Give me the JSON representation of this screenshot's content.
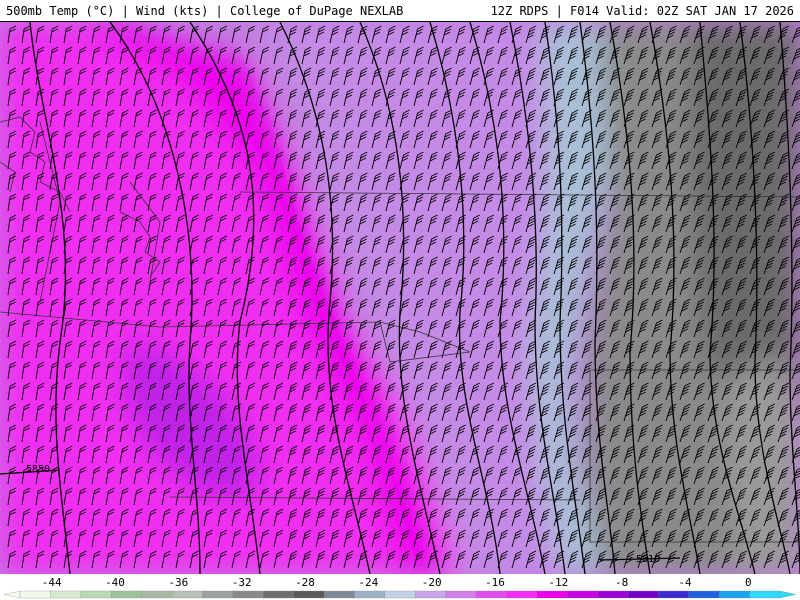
{
  "header": {
    "left": "500mb Temp (°C) | Wind (kts) | College of DuPage NEXLAB",
    "right": "12Z RDPS | F014 Valid: 02Z SAT JAN 17 2026"
  },
  "contour_labels": [
    "5850",
    "5610"
  ],
  "colorbar": {
    "ticks": [
      "-44",
      "-40",
      "-36",
      "-32",
      "-28",
      "-24",
      "-20",
      "-16",
      "-12",
      "-8",
      "-4",
      "0"
    ],
    "tick_values": [
      -44,
      -40,
      -36,
      -32,
      -28,
      -24,
      -20,
      -16,
      -12,
      -8,
      -4,
      0
    ],
    "min": -46,
    "max": 2,
    "colors": [
      "#f2f8ec",
      "#d6ead0",
      "#b9d9b4",
      "#9cc49a",
      "#a7b9a3",
      "#b6c0b6",
      "#9ea29e",
      "#8a8a8a",
      "#6e6e6e",
      "#5a5a5a",
      "#7c8a98",
      "#9db2c7",
      "#bfd2e6",
      "#c9a6e8",
      "#d27de8",
      "#e04ef0",
      "#f32cf5",
      "#ee00ee",
      "#c800e6",
      "#9e00d8",
      "#7200ca",
      "#3a2bd2",
      "#2060e0",
      "#18a4f0",
      "#30d8f8"
    ]
  },
  "colors": {
    "frame": "#000000",
    "contour": "#000000",
    "barb": "#000000",
    "border": "#333333"
  }
}
